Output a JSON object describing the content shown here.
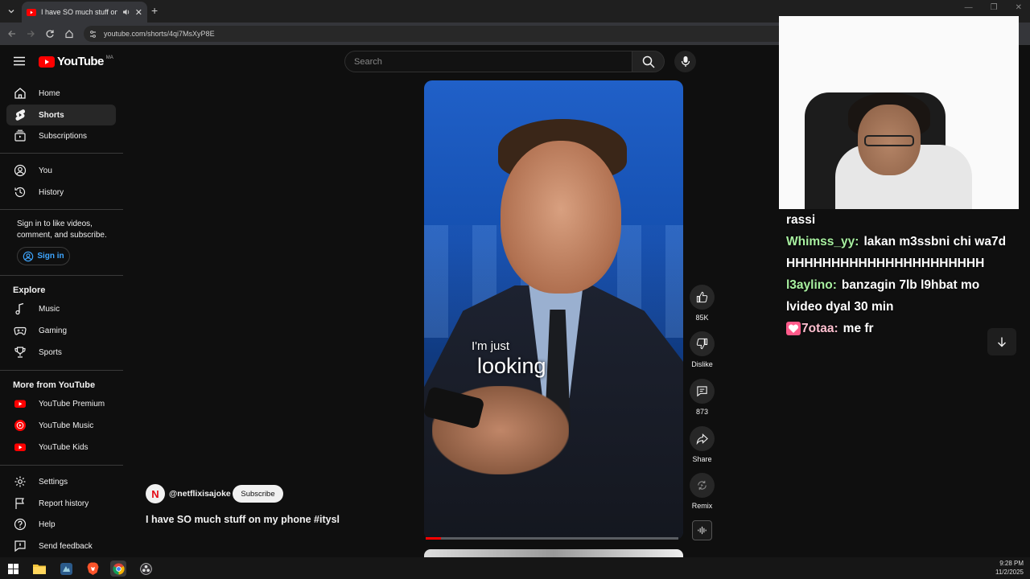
{
  "browser": {
    "tab_title": "I have SO much stuff on my",
    "url": "youtube.com/shorts/4qi7MsXyP8E"
  },
  "header": {
    "logo_text": "YouTube",
    "country_code": "MA",
    "search_placeholder": "Search"
  },
  "sidebar": {
    "main": [
      {
        "label": "Home",
        "icon": "home-icon"
      },
      {
        "label": "Shorts",
        "icon": "shorts-icon",
        "active": true
      },
      {
        "label": "Subscriptions",
        "icon": "subscriptions-icon"
      }
    ],
    "you": [
      {
        "label": "You",
        "icon": "user-circle-icon"
      },
      {
        "label": "History",
        "icon": "history-icon"
      }
    ],
    "signin_prompt": "Sign in to like videos, comment, and subscribe.",
    "signin_label": "Sign in",
    "explore_heading": "Explore",
    "explore": [
      {
        "label": "Music",
        "icon": "music-note-icon"
      },
      {
        "label": "Gaming",
        "icon": "gamepad-icon"
      },
      {
        "label": "Sports",
        "icon": "trophy-icon"
      }
    ],
    "more_heading": "More from YouTube",
    "more": [
      {
        "label": "YouTube Premium",
        "icon": "youtube-premium-icon"
      },
      {
        "label": "YouTube Music",
        "icon": "youtube-music-icon"
      },
      {
        "label": "YouTube Kids",
        "icon": "youtube-kids-icon"
      }
    ],
    "footer": [
      {
        "label": "Settings",
        "icon": "gear-icon"
      },
      {
        "label": "Report history",
        "icon": "flag-icon"
      },
      {
        "label": "Help",
        "icon": "help-icon"
      },
      {
        "label": "Send feedback",
        "icon": "feedback-icon"
      }
    ]
  },
  "short": {
    "caption_line1": "I'm just",
    "caption_line2": "looking",
    "progress": 0.06,
    "channel_initial": "N",
    "channel": "@netflixisajoke",
    "subscribe_label": "Subscribe",
    "title": "I have SO much stuff on my phone #itysl"
  },
  "actions": {
    "like_count": "85K",
    "dislike_label": "Dislike",
    "comment_count": "873",
    "share_label": "Share",
    "remix_label": "Remix"
  },
  "chat": [
    {
      "name": "",
      "name_color": "#ffffff",
      "text": "rassi"
    },
    {
      "name": "Whimss_yy:",
      "name_color": "#a8f0a0",
      "text": "lakan m3ssbni chi wa7d"
    },
    {
      "name": "",
      "name_color": "#ffffff",
      "text": "HHHHHHHHHHHHHHHHHHHHHH"
    },
    {
      "name": "l3aylino:",
      "name_color": "#a8f0a0",
      "text": "banzagin 7lb l9hbat mo lvideo dyal 30 min"
    },
    {
      "name": "7otaa:",
      "name_color": "#ffc0d0",
      "text": "me fr",
      "badge": "heart-badge-icon"
    }
  ],
  "taskbar": {
    "time": "9:28 PM",
    "date": "11/2/2025"
  },
  "colors": {
    "accent": "#3ea6ff",
    "youtube_red": "#ff0000",
    "background": "#0f0f0f"
  }
}
